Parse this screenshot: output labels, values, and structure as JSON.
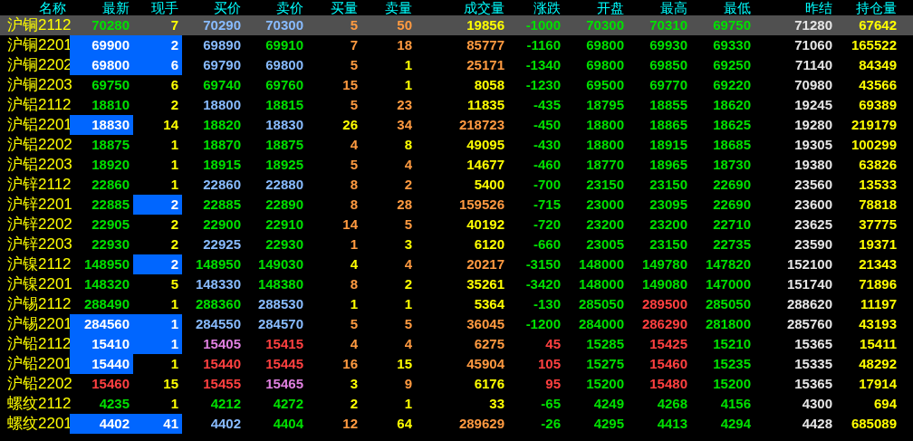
{
  "table": {
    "columns": [
      "名称",
      "最新",
      "现手",
      "买价",
      "卖价",
      "买量",
      "卖量",
      "成交量",
      "涨跌",
      "开盘",
      "最高",
      "最低",
      "昨结",
      "持仓量"
    ],
    "rows": [
      {
        "selected": true,
        "cells": [
          {
            "text": "沪铜2112",
            "kind": "name"
          },
          {
            "text": "70280",
            "kind": "fall"
          },
          {
            "text": "7",
            "kind": "volume"
          },
          {
            "text": "70290",
            "kind": "quote_down"
          },
          {
            "text": "70300",
            "kind": "quote_down"
          },
          {
            "text": "5",
            "kind": "active"
          },
          {
            "text": "50",
            "kind": "active"
          },
          {
            "text": "19856",
            "kind": "volume"
          },
          {
            "text": "-1000",
            "kind": "fall"
          },
          {
            "text": "70300",
            "kind": "fall"
          },
          {
            "text": "70310",
            "kind": "fall"
          },
          {
            "text": "69750",
            "kind": "fall"
          },
          {
            "text": "71280",
            "kind": "settle"
          },
          {
            "text": "67642",
            "kind": "volume"
          }
        ]
      },
      {
        "selected": false,
        "cells": [
          {
            "text": "沪铜2201",
            "kind": "name"
          },
          {
            "text": "69900",
            "kind": "flash"
          },
          {
            "text": "2",
            "kind": "flash"
          },
          {
            "text": "69890",
            "kind": "quote_down"
          },
          {
            "text": "69910",
            "kind": "fall"
          },
          {
            "text": "7",
            "kind": "active"
          },
          {
            "text": "18",
            "kind": "active"
          },
          {
            "text": "85777",
            "kind": "active"
          },
          {
            "text": "-1160",
            "kind": "fall"
          },
          {
            "text": "69800",
            "kind": "fall"
          },
          {
            "text": "69930",
            "kind": "fall"
          },
          {
            "text": "69330",
            "kind": "fall"
          },
          {
            "text": "71060",
            "kind": "settle"
          },
          {
            "text": "165522",
            "kind": "volume"
          }
        ]
      },
      {
        "selected": false,
        "cells": [
          {
            "text": "沪铜2202",
            "kind": "name"
          },
          {
            "text": "69800",
            "kind": "flash"
          },
          {
            "text": "6",
            "kind": "flash"
          },
          {
            "text": "69790",
            "kind": "quote_down"
          },
          {
            "text": "69800",
            "kind": "quote_down"
          },
          {
            "text": "5",
            "kind": "active"
          },
          {
            "text": "1",
            "kind": "volume"
          },
          {
            "text": "25171",
            "kind": "active"
          },
          {
            "text": "-1340",
            "kind": "fall"
          },
          {
            "text": "69800",
            "kind": "fall"
          },
          {
            "text": "69850",
            "kind": "fall"
          },
          {
            "text": "69250",
            "kind": "fall"
          },
          {
            "text": "71140",
            "kind": "settle"
          },
          {
            "text": "84349",
            "kind": "volume"
          }
        ]
      },
      {
        "selected": false,
        "cells": [
          {
            "text": "沪铜2203",
            "kind": "name"
          },
          {
            "text": "69750",
            "kind": "fall"
          },
          {
            "text": "6",
            "kind": "volume"
          },
          {
            "text": "69740",
            "kind": "fall"
          },
          {
            "text": "69760",
            "kind": "fall"
          },
          {
            "text": "15",
            "kind": "active"
          },
          {
            "text": "1",
            "kind": "volume"
          },
          {
            "text": "8058",
            "kind": "volume"
          },
          {
            "text": "-1230",
            "kind": "fall"
          },
          {
            "text": "69500",
            "kind": "fall"
          },
          {
            "text": "69770",
            "kind": "fall"
          },
          {
            "text": "69220",
            "kind": "fall"
          },
          {
            "text": "70980",
            "kind": "settle"
          },
          {
            "text": "43566",
            "kind": "volume"
          }
        ]
      },
      {
        "selected": false,
        "cells": [
          {
            "text": "沪铝2112",
            "kind": "name"
          },
          {
            "text": "18810",
            "kind": "fall"
          },
          {
            "text": "2",
            "kind": "volume"
          },
          {
            "text": "18800",
            "kind": "quote_down"
          },
          {
            "text": "18815",
            "kind": "fall"
          },
          {
            "text": "5",
            "kind": "active"
          },
          {
            "text": "23",
            "kind": "active"
          },
          {
            "text": "11835",
            "kind": "volume"
          },
          {
            "text": "-435",
            "kind": "fall"
          },
          {
            "text": "18795",
            "kind": "fall"
          },
          {
            "text": "18855",
            "kind": "fall"
          },
          {
            "text": "18620",
            "kind": "fall"
          },
          {
            "text": "19245",
            "kind": "settle"
          },
          {
            "text": "69389",
            "kind": "volume"
          }
        ]
      },
      {
        "selected": false,
        "cells": [
          {
            "text": "沪铝2201",
            "kind": "name"
          },
          {
            "text": "18830",
            "kind": "flash"
          },
          {
            "text": "14",
            "kind": "volume"
          },
          {
            "text": "18820",
            "kind": "fall"
          },
          {
            "text": "18830",
            "kind": "quote_down"
          },
          {
            "text": "26",
            "kind": "volume"
          },
          {
            "text": "34",
            "kind": "active"
          },
          {
            "text": "218723",
            "kind": "active"
          },
          {
            "text": "-450",
            "kind": "fall"
          },
          {
            "text": "18800",
            "kind": "fall"
          },
          {
            "text": "18865",
            "kind": "fall"
          },
          {
            "text": "18625",
            "kind": "fall"
          },
          {
            "text": "19280",
            "kind": "settle"
          },
          {
            "text": "219179",
            "kind": "volume"
          }
        ]
      },
      {
        "selected": false,
        "cells": [
          {
            "text": "沪铝2202",
            "kind": "name"
          },
          {
            "text": "18875",
            "kind": "fall"
          },
          {
            "text": "1",
            "kind": "volume"
          },
          {
            "text": "18870",
            "kind": "fall"
          },
          {
            "text": "18875",
            "kind": "fall"
          },
          {
            "text": "4",
            "kind": "active"
          },
          {
            "text": "8",
            "kind": "volume"
          },
          {
            "text": "49095",
            "kind": "volume"
          },
          {
            "text": "-430",
            "kind": "fall"
          },
          {
            "text": "18800",
            "kind": "fall"
          },
          {
            "text": "18915",
            "kind": "fall"
          },
          {
            "text": "18685",
            "kind": "fall"
          },
          {
            "text": "19305",
            "kind": "settle"
          },
          {
            "text": "100299",
            "kind": "volume"
          }
        ]
      },
      {
        "selected": false,
        "cells": [
          {
            "text": "沪铝2203",
            "kind": "name"
          },
          {
            "text": "18920",
            "kind": "fall"
          },
          {
            "text": "1",
            "kind": "volume"
          },
          {
            "text": "18915",
            "kind": "fall"
          },
          {
            "text": "18925",
            "kind": "fall"
          },
          {
            "text": "5",
            "kind": "active"
          },
          {
            "text": "4",
            "kind": "active"
          },
          {
            "text": "14677",
            "kind": "volume"
          },
          {
            "text": "-460",
            "kind": "fall"
          },
          {
            "text": "18770",
            "kind": "fall"
          },
          {
            "text": "18965",
            "kind": "fall"
          },
          {
            "text": "18730",
            "kind": "fall"
          },
          {
            "text": "19380",
            "kind": "settle"
          },
          {
            "text": "63826",
            "kind": "volume"
          }
        ]
      },
      {
        "selected": false,
        "cells": [
          {
            "text": "沪锌2112",
            "kind": "name"
          },
          {
            "text": "22860",
            "kind": "fall"
          },
          {
            "text": "1",
            "kind": "volume"
          },
          {
            "text": "22860",
            "kind": "quote_down"
          },
          {
            "text": "22880",
            "kind": "quote_down"
          },
          {
            "text": "8",
            "kind": "active"
          },
          {
            "text": "2",
            "kind": "active"
          },
          {
            "text": "5400",
            "kind": "volume"
          },
          {
            "text": "-700",
            "kind": "fall"
          },
          {
            "text": "23150",
            "kind": "fall"
          },
          {
            "text": "23150",
            "kind": "fall"
          },
          {
            "text": "22690",
            "kind": "fall"
          },
          {
            "text": "23560",
            "kind": "settle"
          },
          {
            "text": "13533",
            "kind": "volume"
          }
        ]
      },
      {
        "selected": false,
        "cells": [
          {
            "text": "沪锌2201",
            "kind": "name"
          },
          {
            "text": "22885",
            "kind": "fall"
          },
          {
            "text": "2",
            "kind": "flash"
          },
          {
            "text": "22885",
            "kind": "fall"
          },
          {
            "text": "22890",
            "kind": "fall"
          },
          {
            "text": "8",
            "kind": "active"
          },
          {
            "text": "28",
            "kind": "active"
          },
          {
            "text": "159526",
            "kind": "active"
          },
          {
            "text": "-715",
            "kind": "fall"
          },
          {
            "text": "23000",
            "kind": "fall"
          },
          {
            "text": "23095",
            "kind": "fall"
          },
          {
            "text": "22690",
            "kind": "fall"
          },
          {
            "text": "23600",
            "kind": "settle"
          },
          {
            "text": "78818",
            "kind": "volume"
          }
        ]
      },
      {
        "selected": false,
        "cells": [
          {
            "text": "沪锌2202",
            "kind": "name"
          },
          {
            "text": "22905",
            "kind": "fall"
          },
          {
            "text": "2",
            "kind": "volume"
          },
          {
            "text": "22900",
            "kind": "fall"
          },
          {
            "text": "22910",
            "kind": "fall"
          },
          {
            "text": "14",
            "kind": "active"
          },
          {
            "text": "5",
            "kind": "active"
          },
          {
            "text": "40192",
            "kind": "volume"
          },
          {
            "text": "-720",
            "kind": "fall"
          },
          {
            "text": "23200",
            "kind": "fall"
          },
          {
            "text": "23200",
            "kind": "fall"
          },
          {
            "text": "22710",
            "kind": "fall"
          },
          {
            "text": "23625",
            "kind": "settle"
          },
          {
            "text": "37775",
            "kind": "volume"
          }
        ]
      },
      {
        "selected": false,
        "cells": [
          {
            "text": "沪锌2203",
            "kind": "name"
          },
          {
            "text": "22930",
            "kind": "fall"
          },
          {
            "text": "2",
            "kind": "volume"
          },
          {
            "text": "22925",
            "kind": "quote_down"
          },
          {
            "text": "22930",
            "kind": "fall"
          },
          {
            "text": "1",
            "kind": "active"
          },
          {
            "text": "3",
            "kind": "volume"
          },
          {
            "text": "6120",
            "kind": "volume"
          },
          {
            "text": "-660",
            "kind": "fall"
          },
          {
            "text": "23005",
            "kind": "fall"
          },
          {
            "text": "23150",
            "kind": "fall"
          },
          {
            "text": "22735",
            "kind": "fall"
          },
          {
            "text": "23590",
            "kind": "settle"
          },
          {
            "text": "19371",
            "kind": "volume"
          }
        ]
      },
      {
        "selected": false,
        "cells": [
          {
            "text": "沪镍2112",
            "kind": "name"
          },
          {
            "text": "148950",
            "kind": "fall"
          },
          {
            "text": "2",
            "kind": "flash"
          },
          {
            "text": "148950",
            "kind": "fall"
          },
          {
            "text": "149030",
            "kind": "fall"
          },
          {
            "text": "4",
            "kind": "volume"
          },
          {
            "text": "4",
            "kind": "active"
          },
          {
            "text": "20217",
            "kind": "active"
          },
          {
            "text": "-3150",
            "kind": "fall"
          },
          {
            "text": "148000",
            "kind": "fall"
          },
          {
            "text": "149780",
            "kind": "fall"
          },
          {
            "text": "147820",
            "kind": "fall"
          },
          {
            "text": "152100",
            "kind": "settle"
          },
          {
            "text": "21343",
            "kind": "volume"
          }
        ]
      },
      {
        "selected": false,
        "cells": [
          {
            "text": "沪镍2201",
            "kind": "name"
          },
          {
            "text": "148320",
            "kind": "fall"
          },
          {
            "text": "5",
            "kind": "volume"
          },
          {
            "text": "148330",
            "kind": "quote_down"
          },
          {
            "text": "148380",
            "kind": "fall"
          },
          {
            "text": "8",
            "kind": "active"
          },
          {
            "text": "2",
            "kind": "volume"
          },
          {
            "text": "35261",
            "kind": "volume"
          },
          {
            "text": "-3420",
            "kind": "fall"
          },
          {
            "text": "148000",
            "kind": "fall"
          },
          {
            "text": "149080",
            "kind": "fall"
          },
          {
            "text": "147000",
            "kind": "fall"
          },
          {
            "text": "151740",
            "kind": "settle"
          },
          {
            "text": "71896",
            "kind": "volume"
          }
        ]
      },
      {
        "selected": false,
        "cells": [
          {
            "text": "沪锡2112",
            "kind": "name"
          },
          {
            "text": "288490",
            "kind": "fall"
          },
          {
            "text": "1",
            "kind": "volume"
          },
          {
            "text": "288360",
            "kind": "fall"
          },
          {
            "text": "288530",
            "kind": "quote_down"
          },
          {
            "text": "1",
            "kind": "volume"
          },
          {
            "text": "1",
            "kind": "volume"
          },
          {
            "text": "5364",
            "kind": "volume"
          },
          {
            "text": "-130",
            "kind": "fall"
          },
          {
            "text": "285050",
            "kind": "fall"
          },
          {
            "text": "289500",
            "kind": "rise"
          },
          {
            "text": "285050",
            "kind": "fall"
          },
          {
            "text": "288620",
            "kind": "settle"
          },
          {
            "text": "11197",
            "kind": "volume"
          }
        ]
      },
      {
        "selected": false,
        "cells": [
          {
            "text": "沪锡2201",
            "kind": "name"
          },
          {
            "text": "284560",
            "kind": "flash"
          },
          {
            "text": "1",
            "kind": "flash"
          },
          {
            "text": "284550",
            "kind": "quote_down"
          },
          {
            "text": "284570",
            "kind": "quote_down"
          },
          {
            "text": "5",
            "kind": "active"
          },
          {
            "text": "5",
            "kind": "active"
          },
          {
            "text": "36045",
            "kind": "active"
          },
          {
            "text": "-1200",
            "kind": "fall"
          },
          {
            "text": "284000",
            "kind": "fall"
          },
          {
            "text": "286290",
            "kind": "rise"
          },
          {
            "text": "281800",
            "kind": "fall"
          },
          {
            "text": "285760",
            "kind": "settle"
          },
          {
            "text": "43193",
            "kind": "volume"
          }
        ]
      },
      {
        "selected": false,
        "cells": [
          {
            "text": "沪铅2112",
            "kind": "name"
          },
          {
            "text": "15410",
            "kind": "flash"
          },
          {
            "text": "1",
            "kind": "flash"
          },
          {
            "text": "15405",
            "kind": "quote_up"
          },
          {
            "text": "15415",
            "kind": "rise"
          },
          {
            "text": "4",
            "kind": "active"
          },
          {
            "text": "4",
            "kind": "active"
          },
          {
            "text": "6275",
            "kind": "active"
          },
          {
            "text": "45",
            "kind": "rise"
          },
          {
            "text": "15285",
            "kind": "fall"
          },
          {
            "text": "15425",
            "kind": "rise"
          },
          {
            "text": "15210",
            "kind": "fall"
          },
          {
            "text": "15365",
            "kind": "settle"
          },
          {
            "text": "15411",
            "kind": "volume"
          }
        ]
      },
      {
        "selected": false,
        "cells": [
          {
            "text": "沪铅2201",
            "kind": "name"
          },
          {
            "text": "15440",
            "kind": "flash"
          },
          {
            "text": "1",
            "kind": "volume"
          },
          {
            "text": "15440",
            "kind": "rise"
          },
          {
            "text": "15445",
            "kind": "rise"
          },
          {
            "text": "16",
            "kind": "active"
          },
          {
            "text": "15",
            "kind": "volume"
          },
          {
            "text": "45904",
            "kind": "active"
          },
          {
            "text": "105",
            "kind": "rise"
          },
          {
            "text": "15275",
            "kind": "fall"
          },
          {
            "text": "15460",
            "kind": "rise"
          },
          {
            "text": "15235",
            "kind": "fall"
          },
          {
            "text": "15335",
            "kind": "settle"
          },
          {
            "text": "48292",
            "kind": "volume"
          }
        ]
      },
      {
        "selected": false,
        "cells": [
          {
            "text": "沪铅2202",
            "kind": "name"
          },
          {
            "text": "15460",
            "kind": "rise"
          },
          {
            "text": "15",
            "kind": "volume"
          },
          {
            "text": "15455",
            "kind": "rise"
          },
          {
            "text": "15465",
            "kind": "quote_up"
          },
          {
            "text": "3",
            "kind": "volume"
          },
          {
            "text": "9",
            "kind": "active"
          },
          {
            "text": "6176",
            "kind": "volume"
          },
          {
            "text": "95",
            "kind": "rise"
          },
          {
            "text": "15200",
            "kind": "fall"
          },
          {
            "text": "15480",
            "kind": "rise"
          },
          {
            "text": "15200",
            "kind": "fall"
          },
          {
            "text": "15365",
            "kind": "settle"
          },
          {
            "text": "17914",
            "kind": "volume"
          }
        ]
      },
      {
        "selected": false,
        "cells": [
          {
            "text": "螺纹2112",
            "kind": "name"
          },
          {
            "text": "4235",
            "kind": "fall"
          },
          {
            "text": "1",
            "kind": "volume"
          },
          {
            "text": "4212",
            "kind": "fall"
          },
          {
            "text": "4272",
            "kind": "fall"
          },
          {
            "text": "2",
            "kind": "volume"
          },
          {
            "text": "1",
            "kind": "volume"
          },
          {
            "text": "33",
            "kind": "volume"
          },
          {
            "text": "-65",
            "kind": "fall"
          },
          {
            "text": "4249",
            "kind": "fall"
          },
          {
            "text": "4268",
            "kind": "fall"
          },
          {
            "text": "4156",
            "kind": "fall"
          },
          {
            "text": "4300",
            "kind": "settle"
          },
          {
            "text": "694",
            "kind": "volume"
          }
        ]
      },
      {
        "selected": false,
        "cells": [
          {
            "text": "螺纹2201",
            "kind": "name"
          },
          {
            "text": "4402",
            "kind": "flash"
          },
          {
            "text": "41",
            "kind": "flash"
          },
          {
            "text": "4402",
            "kind": "quote_down"
          },
          {
            "text": "4404",
            "kind": "fall"
          },
          {
            "text": "12",
            "kind": "active"
          },
          {
            "text": "64",
            "kind": "volume"
          },
          {
            "text": "289629",
            "kind": "active"
          },
          {
            "text": "-26",
            "kind": "fall"
          },
          {
            "text": "4295",
            "kind": "fall"
          },
          {
            "text": "4413",
            "kind": "fall"
          },
          {
            "text": "4294",
            "kind": "fall"
          },
          {
            "text": "4428",
            "kind": "settle"
          },
          {
            "text": "685089",
            "kind": "volume"
          }
        ]
      }
    ]
  }
}
